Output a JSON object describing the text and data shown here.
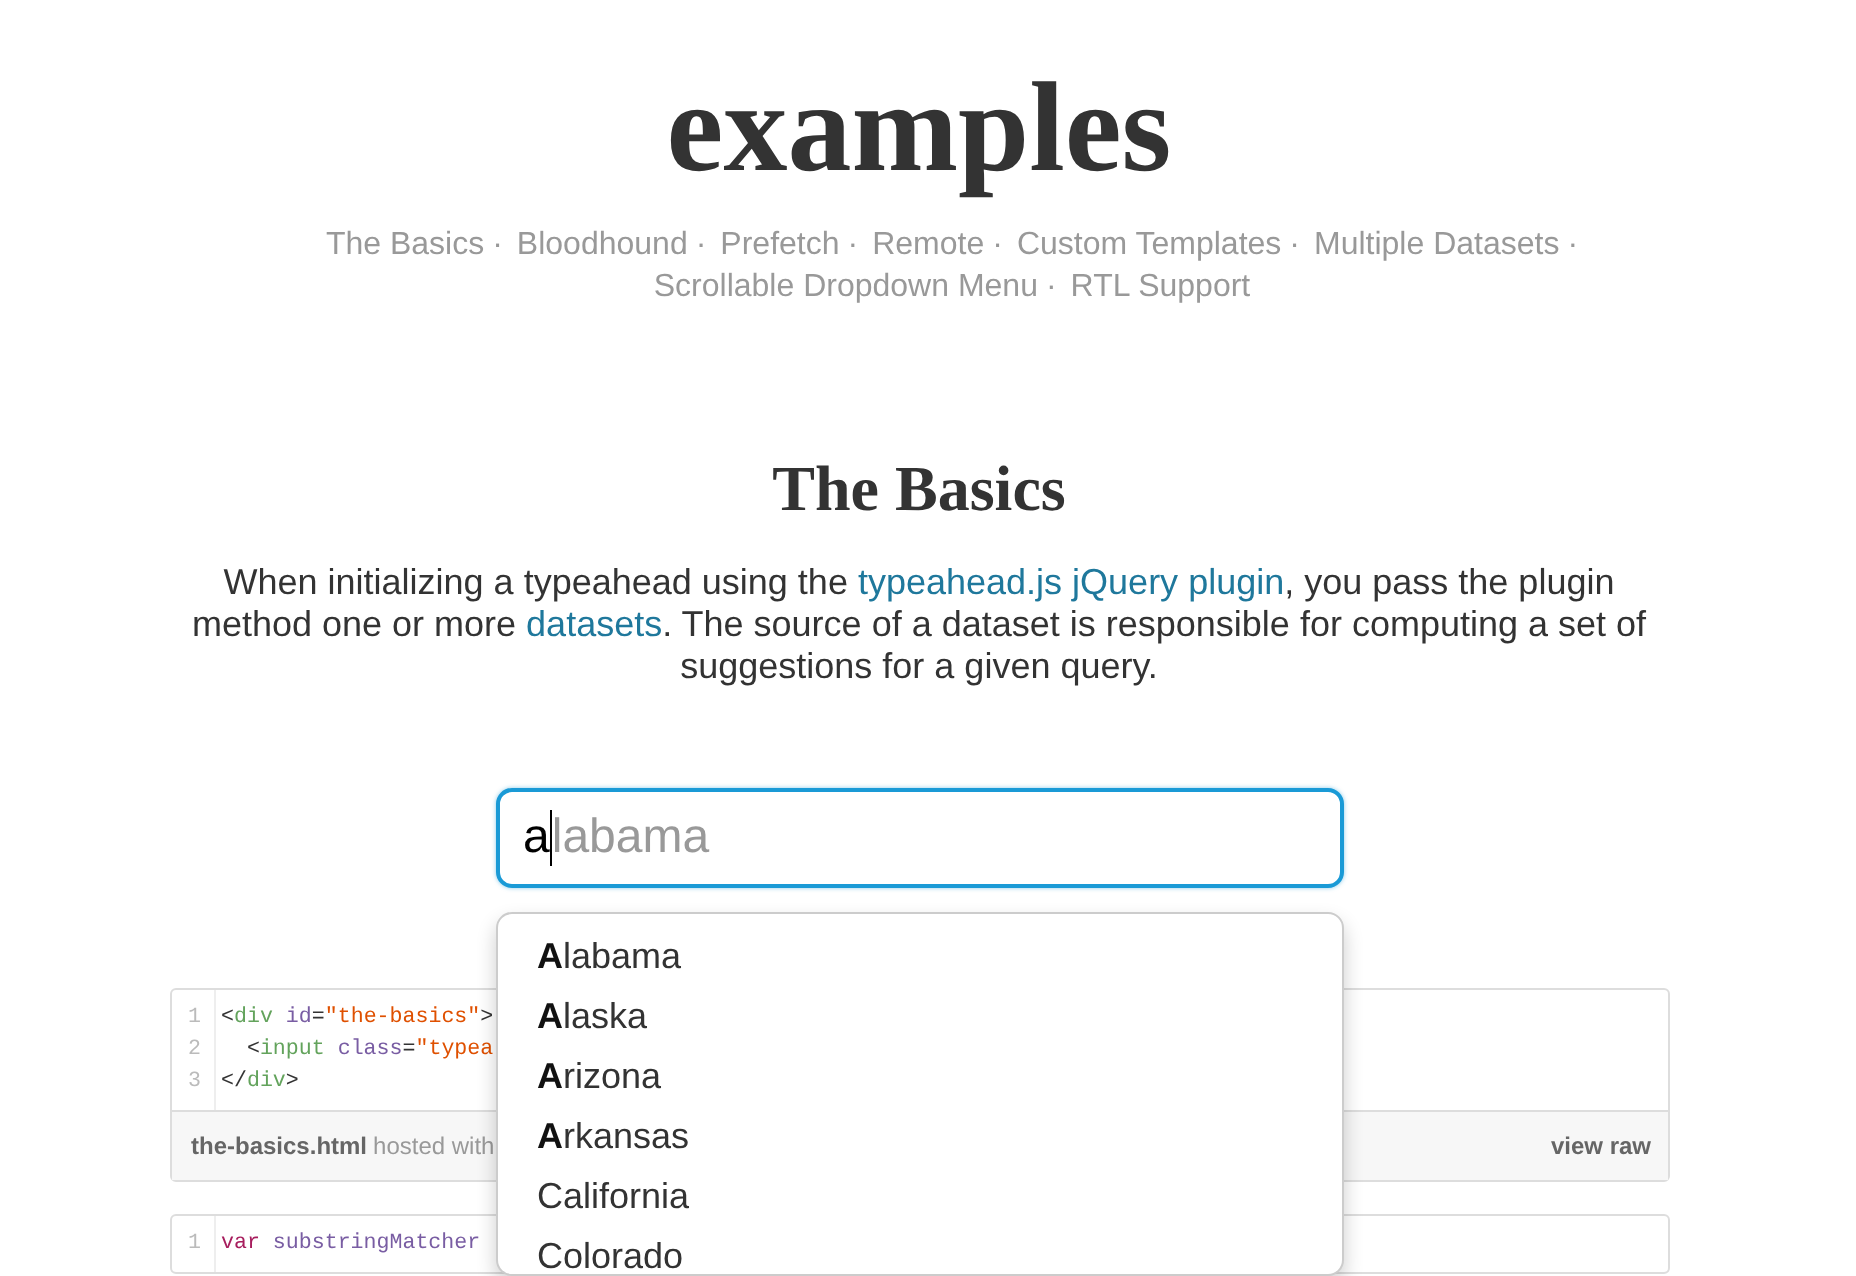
{
  "header": {
    "title": "examples",
    "nav": [
      {
        "label": "The Basics",
        "separator": "·"
      },
      {
        "label": "Bloodhound",
        "separator": "·"
      },
      {
        "label": "Prefetch",
        "separator": "·"
      },
      {
        "label": "Remote",
        "separator": "·"
      },
      {
        "label": "Custom Templates",
        "separator": "·"
      },
      {
        "label": "Multiple Datasets",
        "separator": "·"
      },
      {
        "label": "Scrollable Dropdown Menu",
        "separator": "·"
      },
      {
        "label": "RTL Support"
      }
    ]
  },
  "section": {
    "heading": "The Basics",
    "intro": [
      {
        "kind": "text",
        "text": "When initializing a typeahead using the "
      },
      {
        "kind": "link",
        "text": "typeahead.js jQuery plugin"
      },
      {
        "kind": "text",
        "text": ", you pass the plugin method one or more "
      },
      {
        "kind": "link",
        "text": "datasets"
      },
      {
        "kind": "text",
        "text": ". The source of a dataset is responsible for computing a set of suggestions for a given query."
      }
    ],
    "typeahead": {
      "value": "a",
      "hint": "labama",
      "focused": true,
      "suggestions": [
        {
          "label": "**A**labama",
          "selected": false
        },
        {
          "label": "**A**laska",
          "selected": false
        },
        {
          "label": "**A**rizona",
          "selected": false
        },
        {
          "label": "**A**rkansas",
          "selected": false
        },
        {
          "label": "California",
          "selected": false
        },
        {
          "label": "Colorado",
          "selected": false
        }
      ]
    },
    "gists": [
      {
        "lines": [
          {
            "number": "1",
            "tokens": [
              {
                "kind": "punct",
                "text": "<"
              },
              {
                "kind": "tag",
                "text": "div"
              },
              {
                "kind": "attr",
                "text": " id"
              },
              {
                "kind": "punct",
                "text": "="
              },
              {
                "kind": "string",
                "text": "\"the-basics\""
              },
              {
                "kind": "punct",
                "text": ">"
              }
            ]
          },
          {
            "number": "2",
            "tokens": [
              {
                "kind": "punct",
                "text": "  <"
              },
              {
                "kind": "tag",
                "text": "input"
              },
              {
                "kind": "attr",
                "text": " class"
              },
              {
                "kind": "punct",
                "text": "="
              },
              {
                "kind": "string",
                "text": "\"typea"
              }
            ]
          },
          {
            "number": "3",
            "tokens": [
              {
                "kind": "punct",
                "text": "</"
              },
              {
                "kind": "tag",
                "text": "div"
              },
              {
                "kind": "punct",
                "text": ">"
              }
            ]
          }
        ],
        "footer": {
          "file": "the-basics.html",
          "note": "hosted with",
          "raw": "view raw"
        }
      },
      {
        "lines": [
          {
            "number": "1",
            "tokens": [
              {
                "kind": "keyword",
                "text": "var"
              },
              {
                "kind": "name",
                "text": " substringMatcher"
              }
            ]
          }
        ]
      }
    ]
  }
}
